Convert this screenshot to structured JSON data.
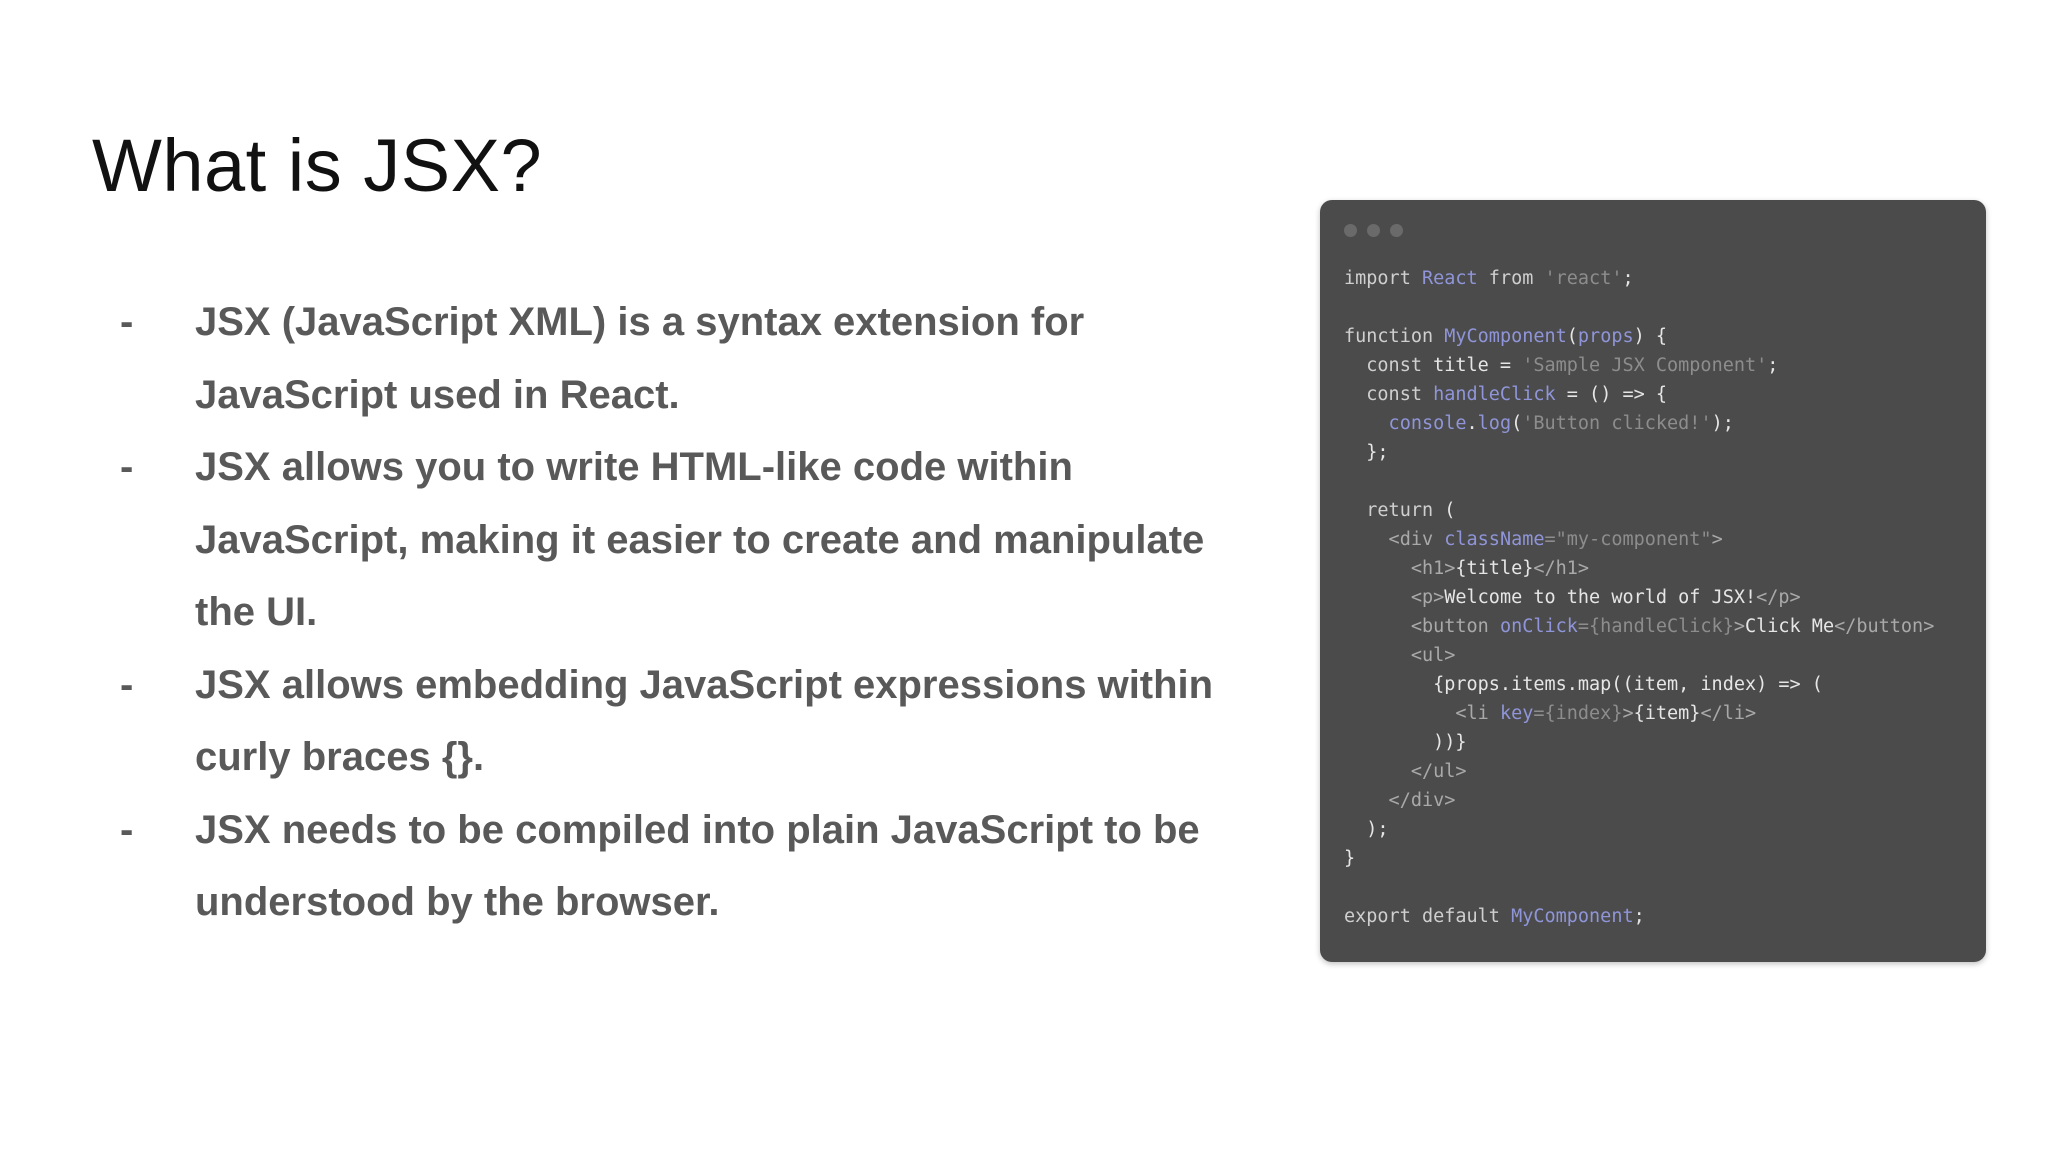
{
  "slide": {
    "title": "What is JSX?",
    "bullets": [
      {
        "marker": "-",
        "text": "JSX (JavaScript XML) is a syntax extension for JavaScript used in React."
      },
      {
        "marker": "-",
        "text": "JSX allows you to write HTML-like code within JavaScript, making it easier to create and manipulate the UI."
      },
      {
        "marker": "-",
        "text": "JSX allows embedding JavaScript expressions within curly braces {}."
      },
      {
        "marker": "-",
        "text": "JSX needs to be compiled into plain JavaScript to be understood by the browser."
      }
    ]
  },
  "code_window": {
    "colors": {
      "background": "#4b4b4b",
      "keyword": "#cfcfcf",
      "identifier": "#8f95d8",
      "string": "#8d8d8d",
      "tag": "#a9a9a9"
    },
    "lines": [
      [
        [
          "kw",
          "import "
        ],
        [
          "id",
          "React"
        ],
        [
          "kw",
          " from "
        ],
        [
          "str",
          "'react'"
        ],
        [
          "plain",
          ";"
        ]
      ],
      [],
      [
        [
          "kw",
          "function "
        ],
        [
          "id",
          "MyComponent"
        ],
        [
          "plain",
          "("
        ],
        [
          "id",
          "props"
        ],
        [
          "plain",
          ") {"
        ]
      ],
      [
        [
          "kw",
          "  const "
        ],
        [
          "plain",
          "title = "
        ],
        [
          "str",
          "'Sample JSX Component'"
        ],
        [
          "plain",
          ";"
        ]
      ],
      [
        [
          "kw",
          "  const "
        ],
        [
          "id",
          "handleClick"
        ],
        [
          "plain",
          " = () => {"
        ]
      ],
      [
        [
          "id",
          "    console"
        ],
        [
          "plain",
          "."
        ],
        [
          "id",
          "log"
        ],
        [
          "plain",
          "("
        ],
        [
          "str",
          "'Button clicked!'"
        ],
        [
          "plain",
          ");"
        ]
      ],
      [
        [
          "plain",
          "  };"
        ]
      ],
      [],
      [
        [
          "kw",
          "  return "
        ],
        [
          "plain",
          "("
        ]
      ],
      [
        [
          "tag",
          "    <div "
        ],
        [
          "attr",
          "className"
        ],
        [
          "str",
          "=\"my-component\""
        ],
        [
          "tag",
          ">"
        ]
      ],
      [
        [
          "tag",
          "      <h1>"
        ],
        [
          "plain",
          "{title}"
        ],
        [
          "tag",
          "</h1>"
        ]
      ],
      [
        [
          "tag",
          "      <p>"
        ],
        [
          "plain",
          "Welcome to the world of JSX!"
        ],
        [
          "tag",
          "</p>"
        ]
      ],
      [
        [
          "tag",
          "      <button "
        ],
        [
          "attr",
          "onClick"
        ],
        [
          "str",
          "={handleClick}"
        ],
        [
          "tag",
          ">"
        ],
        [
          "plain",
          "Click Me"
        ],
        [
          "tag",
          "</button>"
        ]
      ],
      [
        [
          "tag",
          "      <ul>"
        ]
      ],
      [
        [
          "plain",
          "        {props.items.map((item, index) => ("
        ]
      ],
      [
        [
          "tag",
          "          <li "
        ],
        [
          "attr",
          "key"
        ],
        [
          "str",
          "={index}"
        ],
        [
          "tag",
          ">"
        ],
        [
          "plain",
          "{item}"
        ],
        [
          "tag",
          "</li>"
        ]
      ],
      [
        [
          "plain",
          "        ))}"
        ]
      ],
      [
        [
          "tag",
          "      </ul>"
        ]
      ],
      [
        [
          "tag",
          "    </div>"
        ]
      ],
      [
        [
          "plain",
          "  );"
        ]
      ],
      [
        [
          "plain",
          "}"
        ]
      ],
      [],
      [
        [
          "kw",
          "export default "
        ],
        [
          "id",
          "MyComponent"
        ],
        [
          "plain",
          ";"
        ]
      ]
    ]
  }
}
